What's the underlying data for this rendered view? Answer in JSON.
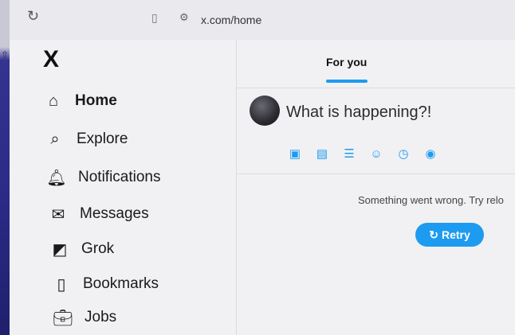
{
  "browser": {
    "url": "x.com/home",
    "icons": {
      "reload": "reload-icon",
      "bookmark": "bookmark-icon",
      "site_settings": "tune-icon"
    }
  },
  "brand": {
    "logo": "X",
    "accent_color": "#1d9bf0"
  },
  "sidebar": {
    "items": [
      {
        "label": "Home",
        "icon": "home-icon",
        "active": true
      },
      {
        "label": "Explore",
        "icon": "search-icon",
        "active": false
      },
      {
        "label": "Notifications",
        "icon": "bell-icon",
        "active": false
      },
      {
        "label": "Messages",
        "icon": "mail-icon",
        "active": false
      },
      {
        "label": "Grok",
        "icon": "grok-icon",
        "active": false
      },
      {
        "label": "Bookmarks",
        "icon": "bookmark-icon",
        "active": false
      },
      {
        "label": "Jobs",
        "icon": "briefcase-icon",
        "active": false
      }
    ]
  },
  "main": {
    "tab_label": "For you",
    "compose_placeholder": "What is happening?!",
    "tools": [
      "image-icon",
      "gif-icon",
      "poll-icon",
      "emoji-icon",
      "schedule-icon",
      "location-icon"
    ],
    "error_message": "Something went wrong. Try relo",
    "retry_label": "Retry"
  }
}
